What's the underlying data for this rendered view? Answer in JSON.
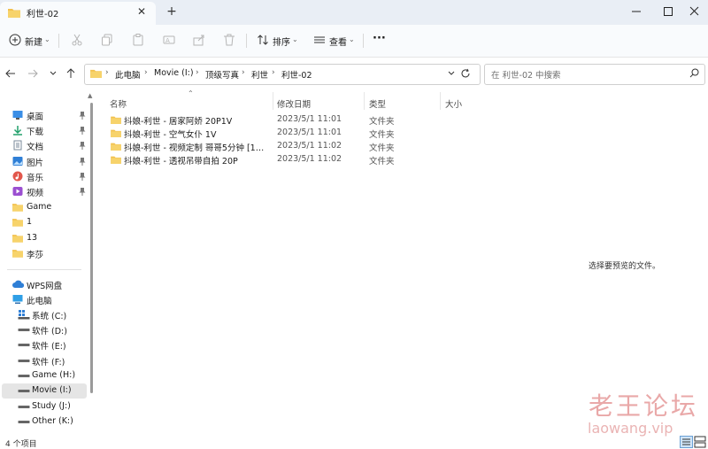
{
  "window": {
    "tab_title": "利世-02",
    "new_tab_symbol": "+",
    "close_symbol": "✕"
  },
  "toolbar": {
    "new_label": "新建",
    "sort_label": "排序",
    "view_label": "查看",
    "more_label": "···"
  },
  "address": {
    "crumbs": [
      "此电脑",
      "Movie (I:)",
      "顶级写真",
      "利世",
      "利世-02"
    ],
    "search_placeholder": "在 利世-02 中搜索"
  },
  "sidebar": {
    "quick": [
      {
        "label": "桌面",
        "icon": "desktop-icon",
        "color": "#3a8ee6"
      },
      {
        "label": "下载",
        "icon": "download-icon",
        "color": "#22a06b"
      },
      {
        "label": "文档",
        "icon": "document-icon",
        "color": "#7a8a9a"
      },
      {
        "label": "图片",
        "icon": "pictures-icon",
        "color": "#2f7fd6"
      },
      {
        "label": "音乐",
        "icon": "music-icon",
        "color": "#e2574c"
      },
      {
        "label": "视频",
        "icon": "video-icon",
        "color": "#9b4fd1"
      },
      {
        "label": "Game",
        "icon": "folder-icon",
        "color": "#f5c542"
      },
      {
        "label": "1",
        "icon": "folder-icon",
        "color": "#f5c542"
      },
      {
        "label": "13",
        "icon": "folder-icon",
        "color": "#f5c542"
      },
      {
        "label": "李莎",
        "icon": "folder-icon",
        "color": "#f5c542"
      }
    ],
    "wps_label": "WPS网盘",
    "pc_label": "此电脑",
    "drives": [
      {
        "label": "系统 (C:)"
      },
      {
        "label": "软件 (D:)"
      },
      {
        "label": "软件 (E:)"
      },
      {
        "label": "软件 (F:)"
      },
      {
        "label": "Game (H:)"
      },
      {
        "label": "Movie (I:)"
      },
      {
        "label": "Study (J:)"
      },
      {
        "label": "Other (K:)"
      }
    ]
  },
  "columns": {
    "name": "名称",
    "date": "修改日期",
    "type": "类型",
    "size": "大小"
  },
  "files": [
    {
      "name": "抖娘-利世 - 居家阿娇 20P1V",
      "date": "2023/5/1 11:01",
      "type": "文件夹"
    },
    {
      "name": "抖娘-利世 - 空气女仆 1V",
      "date": "2023/5/1 11:01",
      "type": "文件夹"
    },
    {
      "name": "抖娘-利世 - 视频定制 哥哥5分钟 [1V-97...",
      "date": "2023/5/1 11:02",
      "type": "文件夹"
    },
    {
      "name": "抖娘-利世 - 透视吊带自拍 20P",
      "date": "2023/5/1 11:02",
      "type": "文件夹"
    }
  ],
  "preview_text": "选择要预览的文件。",
  "status": {
    "count": "4 个项目"
  },
  "watermark": {
    "cn": "老王论坛",
    "en": "laowang.vip"
  }
}
